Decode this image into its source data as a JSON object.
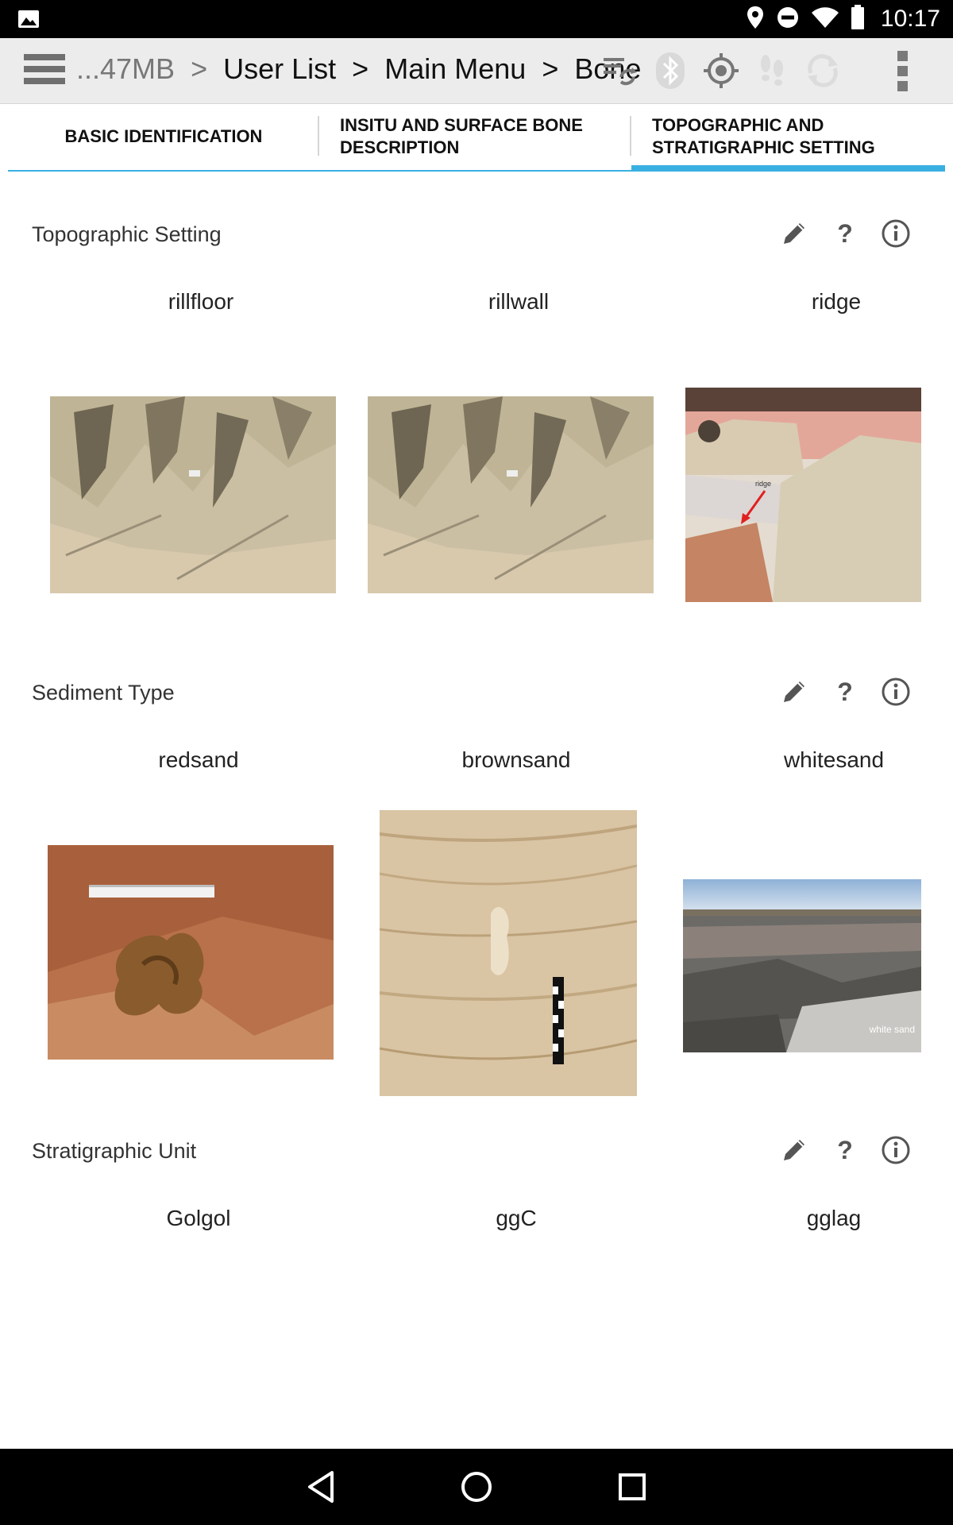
{
  "status_bar": {
    "time": "10:17",
    "icons": [
      "gallery-icon",
      "location-icon",
      "do-not-disturb-icon",
      "wifi-icon",
      "battery-icon"
    ]
  },
  "action_bar": {
    "breadcrumb": {
      "storage": "...47MB",
      "separator": ">",
      "items": [
        "User List",
        "Main Menu",
        "Bone"
      ]
    },
    "icons": [
      "sync-settings-icon",
      "bluetooth-icon",
      "gps-icon",
      "footsteps-icon",
      "refresh-icon",
      "overflow-menu-icon"
    ]
  },
  "tabs": [
    {
      "label_line1": "BASIC IDENTIFICATION",
      "label_line2": "",
      "active": false
    },
    {
      "label_line1": "INSITU AND SURFACE BONE",
      "label_line2": "DESCRIPTION",
      "active": false
    },
    {
      "label_line1": "TOPOGRAPHIC AND",
      "label_line2": "STRATIGRAPHIC SETTING",
      "active": true
    }
  ],
  "sections": [
    {
      "title": "Topographic Setting",
      "options": [
        {
          "label": "rillfloor",
          "image": "rill-landscape-photo"
        },
        {
          "label": "rillwall",
          "image": "rill-landscape-photo"
        },
        {
          "label": "ridge",
          "image": "ridge-photo",
          "annotation": "ridge"
        }
      ]
    },
    {
      "title": "Sediment Type",
      "options": [
        {
          "label": "redsand",
          "image": "red-sand-photo"
        },
        {
          "label": "brownsand",
          "image": "brown-sand-photo"
        },
        {
          "label": "whitesand",
          "image": "white-sand-photo",
          "caption": "white sand"
        }
      ]
    },
    {
      "title": "Stratigraphic Unit",
      "options": [
        {
          "label": "Golgol"
        },
        {
          "label": "ggC"
        },
        {
          "label": "gglag"
        }
      ]
    }
  ],
  "colors": {
    "accent": "#3ab0e2",
    "action_bar_bg": "#ececec",
    "icon_gray": "#6f6f6f"
  },
  "nav_bar": {
    "icons": [
      "back-icon",
      "home-icon",
      "recents-icon"
    ]
  }
}
